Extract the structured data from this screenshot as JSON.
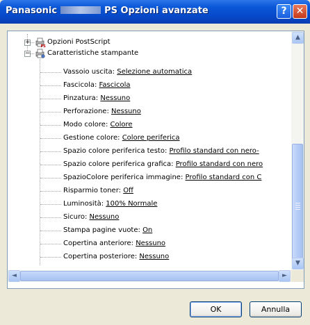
{
  "window": {
    "title_prefix": "Panasonic",
    "title_suffix": "PS Opzioni avanzate",
    "help_glyph": "?",
    "close_glyph": "✕"
  },
  "tree": {
    "node_postscript": "Opzioni PostScript",
    "node_printer": "Caratteristiche stampante",
    "items": [
      {
        "label": "Vassoio uscita: ",
        "value": "Selezione automatica"
      },
      {
        "label": "Fascicola: ",
        "value": "Fascicola"
      },
      {
        "label": "Pinzatura: ",
        "value": "Nessuno"
      },
      {
        "label": "Perforazione: ",
        "value": "Nessuno"
      },
      {
        "label": "Modo colore: ",
        "value": "Colore"
      },
      {
        "label": "Gestione colore: ",
        "value": "Colore periferica"
      },
      {
        "label": "Spazio colore periferica testo: ",
        "value": "Profilo standard con nero-"
      },
      {
        "label": "Spazio colore periferica grafica: ",
        "value": "Profilo standard con nero"
      },
      {
        "label": "SpazioColore periferica immagine: ",
        "value": "Profilo standard con C"
      },
      {
        "label": "Risparmio toner: ",
        "value": "Off"
      },
      {
        "label": "Luminosità: ",
        "value": "100% Normale"
      },
      {
        "label": "Sicuro: ",
        "value": "Nessuno"
      },
      {
        "label": "Stampa pagine vuote: ",
        "value": "On"
      },
      {
        "label": "Copertina anteriore: ",
        "value": "Nessuno"
      },
      {
        "label": "Copertina posteriore: ",
        "value": "Nessuno"
      }
    ]
  },
  "scrollbars": {
    "up": "▲",
    "down": "▼",
    "left": "◄",
    "right": "►"
  },
  "buttons": {
    "ok": "OK",
    "cancel": "Annulla"
  },
  "colors": {
    "titlebar": "#0a58d8",
    "link_value": "#000000"
  }
}
